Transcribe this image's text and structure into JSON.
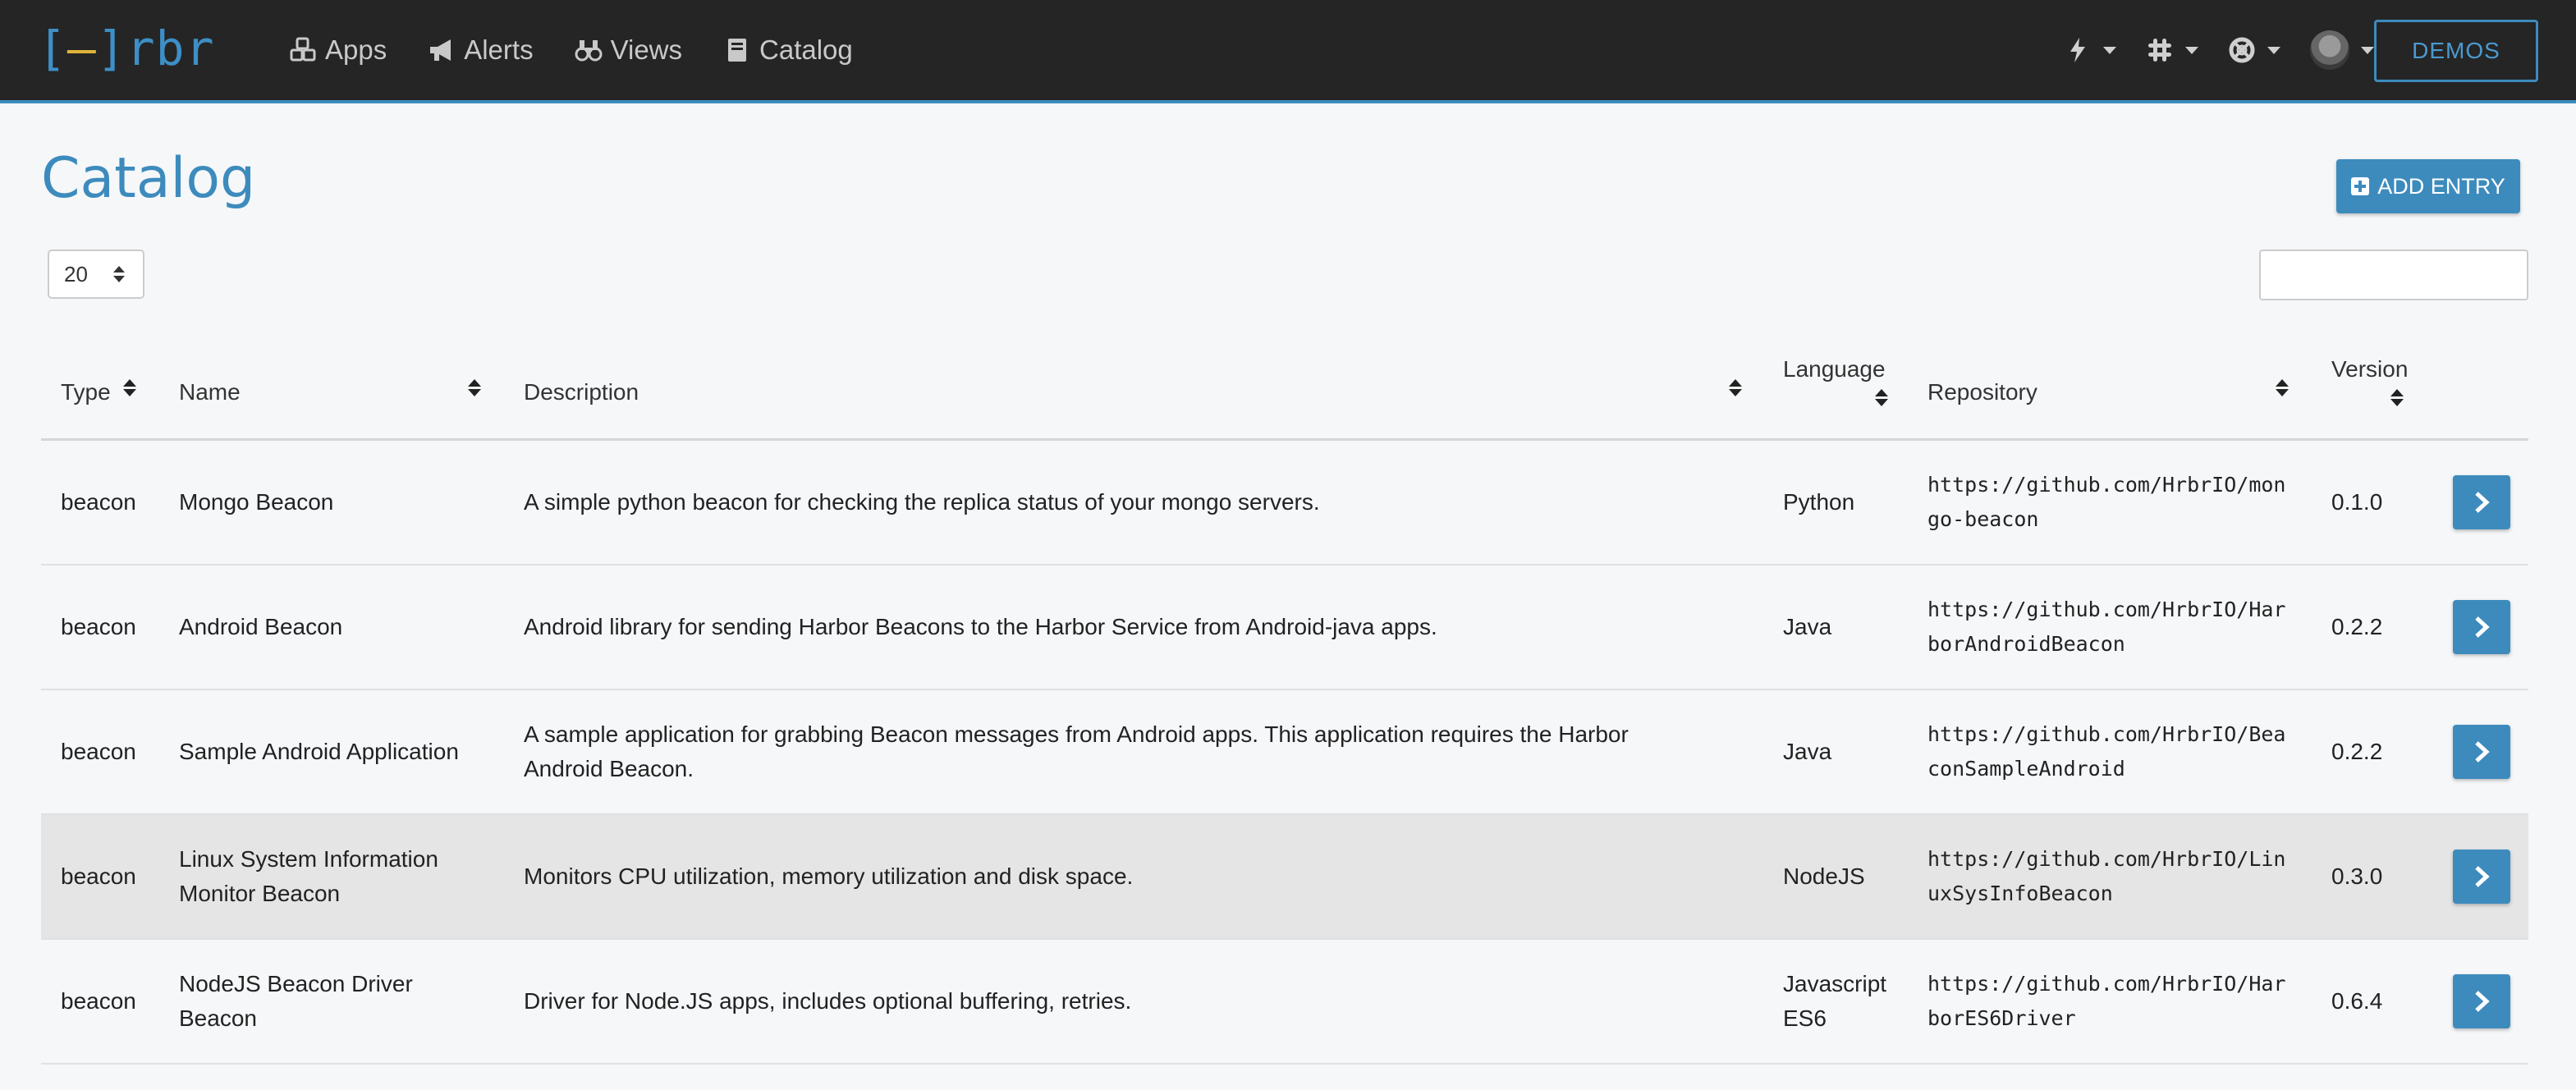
{
  "brand": {
    "logo_bracket_left": "[",
    "logo_dash": "–",
    "logo_bracket_right": "]",
    "logo_text": "rbr"
  },
  "nav": [
    {
      "label": "Apps",
      "icon": "cubes-icon"
    },
    {
      "label": "Alerts",
      "icon": "bullhorn-icon"
    },
    {
      "label": "Views",
      "icon": "binoculars-icon"
    },
    {
      "label": "Catalog",
      "icon": "book-icon"
    }
  ],
  "header_right": {
    "tools": [
      "bolt-icon",
      "slack-icon",
      "life-ring-icon",
      "avatar"
    ],
    "demos_label": "DEMOS"
  },
  "page": {
    "title": "Catalog",
    "add_entry_label": "ADD ENTRY",
    "page_size": "20",
    "search_value": ""
  },
  "table": {
    "columns": [
      "Type",
      "Name",
      "Description",
      "Language",
      "Repository",
      "Version"
    ],
    "rows": [
      {
        "type": "beacon",
        "name": [
          "Mongo Beacon"
        ],
        "description": [
          "A simple python beacon for checking the replica status of your mongo servers."
        ],
        "language": [
          "Python"
        ],
        "repository": [
          "https://github.com/HrbrIO/mon",
          "go-beacon"
        ],
        "version": "0.1.0"
      },
      {
        "type": "beacon",
        "name": [
          "Android Beacon"
        ],
        "description": [
          "Android library for sending Harbor Beacons to the Harbor Service from Android-java apps."
        ],
        "language": [
          "Java"
        ],
        "repository": [
          "https://github.com/HrbrIO/Har",
          "borAndroidBeacon"
        ],
        "version": "0.2.2"
      },
      {
        "type": "beacon",
        "name": [
          "Sample Android Application"
        ],
        "description": [
          "A sample application for grabbing Beacon messages from Android apps. This application requires the Harbor",
          "Android Beacon."
        ],
        "language": [
          "Java"
        ],
        "repository": [
          "https://github.com/HrbrIO/Bea",
          "conSampleAndroid"
        ],
        "version": "0.2.2"
      },
      {
        "type": "beacon",
        "name": [
          "Linux System Information",
          "Monitor Beacon"
        ],
        "description": [
          "Monitors CPU utilization, memory utilization and disk space."
        ],
        "language": [
          "NodeJS"
        ],
        "repository": [
          "https://github.com/HrbrIO/Lin",
          "uxSysInfoBeacon"
        ],
        "version": "0.3.0"
      },
      {
        "type": "beacon",
        "name": [
          "NodeJS Beacon Driver",
          "Beacon"
        ],
        "description": [
          "Driver for Node.JS apps, includes optional buffering, retries."
        ],
        "language": [
          "Javascript",
          "ES6"
        ],
        "repository": [
          "https://github.com/HrbrIO/Har",
          "borES6Driver"
        ],
        "version": "0.6.4"
      }
    ]
  },
  "colors": {
    "accent": "#3d8bbd",
    "topbar": "#252525",
    "logo_dash": "#e0b43a",
    "row_highlight": "#e5e5e5"
  }
}
